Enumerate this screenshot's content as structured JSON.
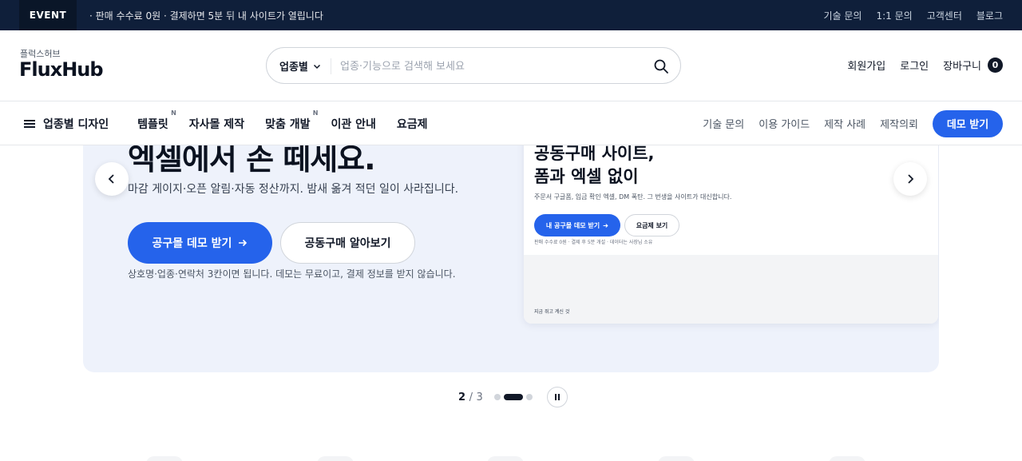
{
  "event_bar": {
    "tag": "EVENT",
    "text": "· 판매 수수료 0원 · 결제하면 5분 뒤 내 사이트가 열립니다",
    "links": [
      "기술 문의",
      "1:1 문의",
      "고객센터",
      "블로그"
    ]
  },
  "header": {
    "logo_sub": "플럭스허브",
    "logo": "FluxHub",
    "search": {
      "category": "업종별",
      "placeholder": "업종·기능으로 검색해 보세요"
    },
    "actions": {
      "signup": "회원가입",
      "login": "로그인",
      "cart": "장바구니",
      "cart_count": "0"
    }
  },
  "nav": {
    "menu": "업종별 디자인",
    "items": [
      {
        "label": "템플릿",
        "badge": "N"
      },
      {
        "label": "자사몰 제작",
        "badge": ""
      },
      {
        "label": "맞춤 개발",
        "badge": "N"
      },
      {
        "label": "이관 안내",
        "badge": ""
      },
      {
        "label": "요금제",
        "badge": ""
      }
    ],
    "right_links": [
      "기술 문의",
      "이용 가이드",
      "제작 사례",
      "제작의뢰"
    ],
    "demo_button": "데모 받기"
  },
  "hero": {
    "title": "엑셀에서 손 떼세요.",
    "description": "마감 게이지·오픈 알림·자동 정산까지. 밤새 옮겨 적던 일이 사라집니다.",
    "primary_button": "공구몰 데모 받기",
    "secondary_button": "공동구매 알아보기",
    "note": "상호명·업종·연락처 3칸이면 됩니다. 데모는 무료이고, 결제 정보를 받지 않습니다.",
    "card": {
      "title_line1": "공동구매 사이트,",
      "title_line2": "폼과 엑셀 없이",
      "description": "주문서 구글폼, 입금 확인 엑셀, DM 폭탄. 그 번생을 사이트가 대신합니다.",
      "button1": "내 공구몰 데모 받기",
      "button2": "요금제 보기",
      "note": "판매 수수료 0원 · 결제 후 5분 개설 · 데이터는 사장님 소유",
      "bottom_text": "지금 쥐고 계신 것"
    }
  },
  "pager": {
    "current": "2",
    "separator": "/",
    "total": "3"
  },
  "icons": {
    "search": "search-icon",
    "chevron": "chevron-down-icon",
    "arrow_left": "chevron-left-icon",
    "arrow_right": "chevron-right-icon",
    "pause": "pause-icon",
    "menu": "hamburger-icon"
  },
  "colors": {
    "event_bar": "#0f1f3a",
    "accent": "#2563eb",
    "hero_bg": "#eef2fb"
  }
}
